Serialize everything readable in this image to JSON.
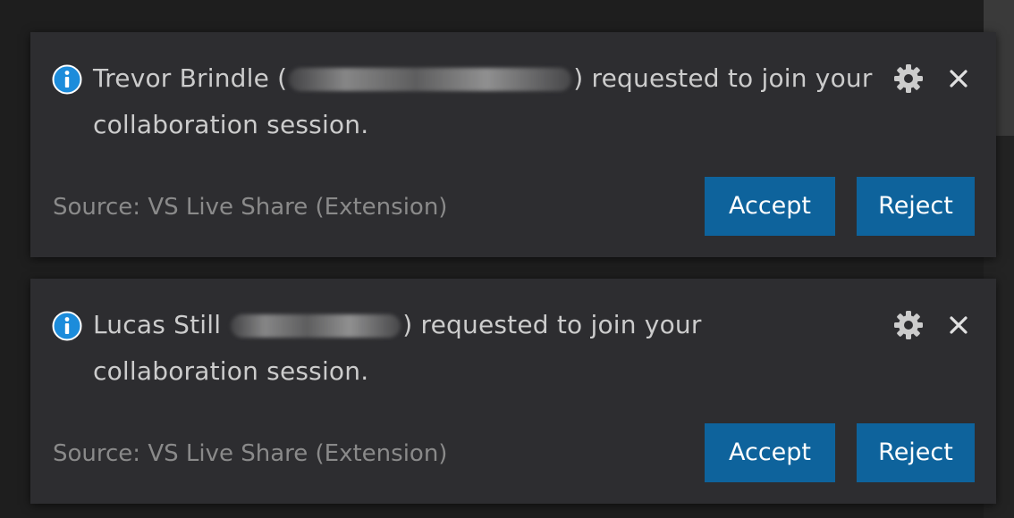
{
  "notifications": [
    {
      "requester_name": "Trevor Brindle",
      "open_paren": "(",
      "close_paren_message": ") requested to join your",
      "message_line2": "collaboration session.",
      "source": "Source: VS Live Share (Extension)",
      "accept_label": "Accept",
      "reject_label": "Reject"
    },
    {
      "requester_name": "Lucas Still",
      "open_paren": "",
      "close_paren_message": ") requested to join your",
      "message_line2": "collaboration session.",
      "source": "Source: VS Live Share (Extension)",
      "accept_label": "Accept",
      "reject_label": "Reject"
    }
  ],
  "icons": {
    "info": "info-icon",
    "settings": "gear-icon",
    "close": "close-icon"
  },
  "colors": {
    "background": "#1e1e1e",
    "toast_background": "#2d2d30",
    "text": "#cccccc",
    "source_text": "#8a8a8a",
    "button": "#0e639c",
    "info_icon": "#1c8cdb"
  }
}
